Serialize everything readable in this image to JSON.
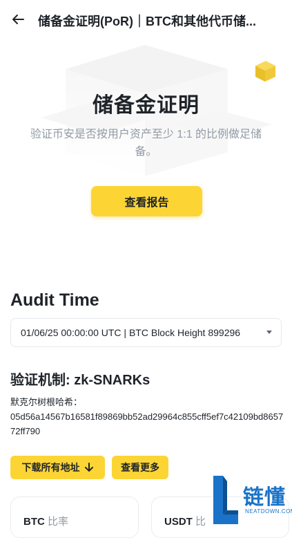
{
  "header": {
    "title": "储备金证明(PoR)｜BTC和其他代币储..."
  },
  "hero": {
    "title": "储备金证明",
    "description": "验证币安是否按用户资产至少 1:1 的比例做足储备。",
    "report_button": "查看报告"
  },
  "audit": {
    "heading": "Audit Time",
    "selected": "01/06/25 00:00:00 UTC | BTC Block Height 899296"
  },
  "mechanism": {
    "heading": "验证机制: zk-SNARKs",
    "hash_label": "默克尔树根哈希：",
    "hash_value": "05d56a14567b16581f89869bb52ad29964c855cff5ef7c42109bd865772ff790"
  },
  "actions": {
    "download_all": "下载所有地址",
    "view_more": "查看更多"
  },
  "cards": [
    {
      "asset": "BTC",
      "suffix": "比率"
    },
    {
      "asset": "USDT",
      "suffix": "比"
    }
  ],
  "watermark": {
    "brand": "链懂",
    "site": "NEATDOWN.COM"
  },
  "colors": {
    "accent": "#fcd535",
    "text": "#1e2329",
    "muted": "#929aa5",
    "watermark": "#1a73c8"
  }
}
